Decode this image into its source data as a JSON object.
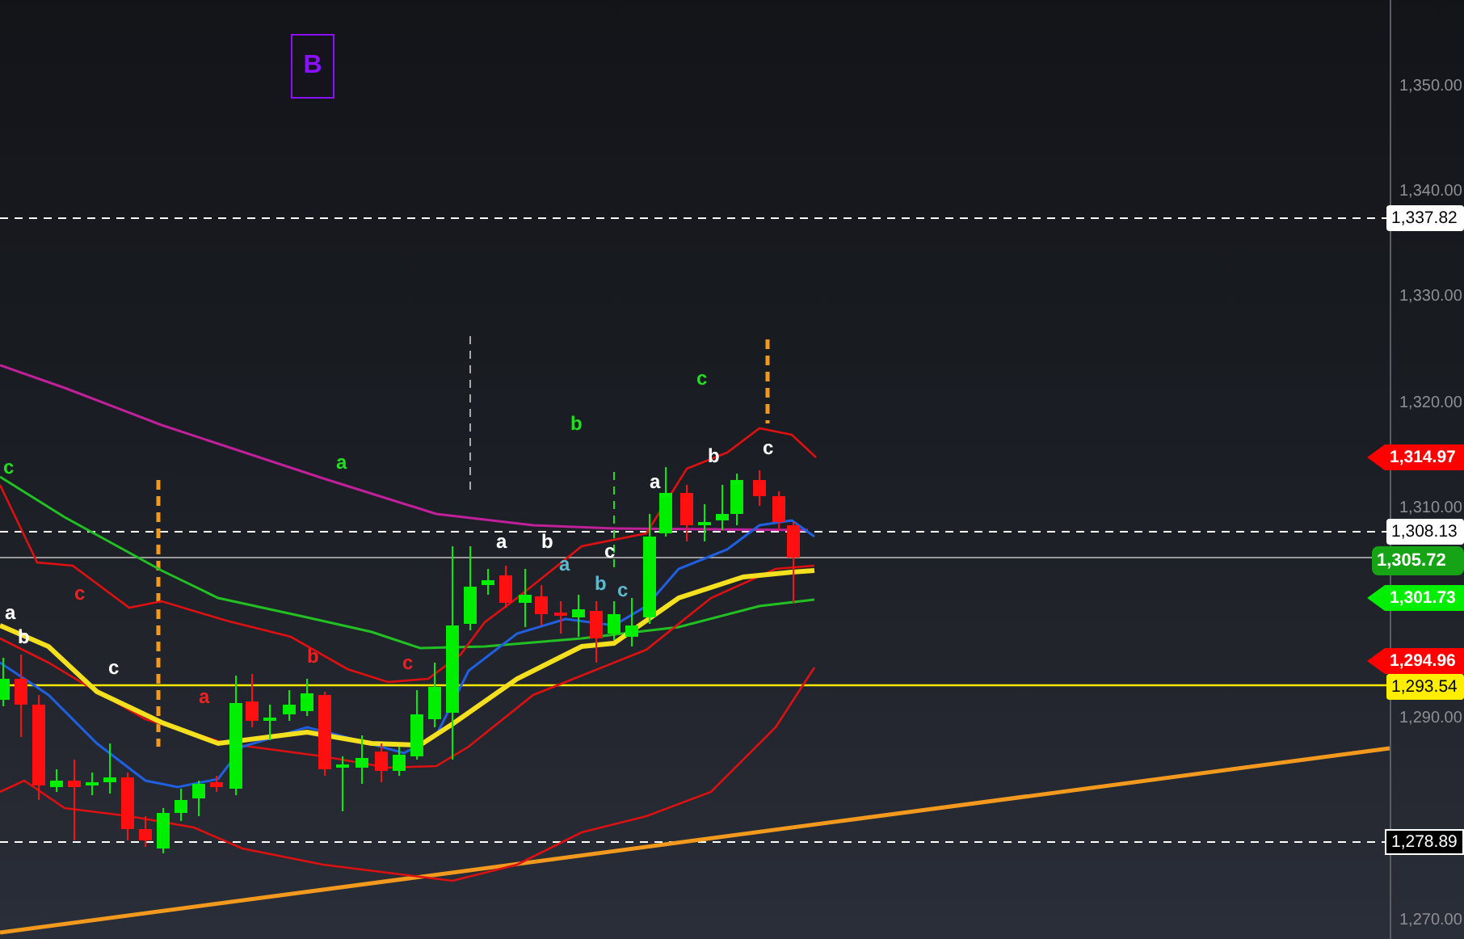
{
  "badge": {
    "text": "B"
  },
  "y_axis": {
    "ticks": [
      "1,350.00",
      "1,340.00",
      "1,330.00",
      "1,320.00",
      "1,310.00",
      "1,290.00",
      "1,270.00"
    ]
  },
  "price_tags": [
    {
      "text": "1,337.82",
      "kind": "box",
      "color": "#ffffff"
    },
    {
      "text": "1,314.97",
      "kind": "arrow",
      "color": "#ff0000"
    },
    {
      "text": "1,308.13",
      "kind": "box",
      "color": "#ffffff"
    },
    {
      "text": "1,305.72",
      "kind": "pill",
      "color": "#16a316"
    },
    {
      "text": "1,301.73",
      "kind": "arrow",
      "color": "#00ee00"
    },
    {
      "text": "1,294.96",
      "kind": "arrow",
      "color": "#ff0000"
    },
    {
      "text": "1,293.54",
      "kind": "box",
      "color": "#ffee00"
    },
    {
      "text": "1,278.89",
      "kind": "outlined",
      "color": "#000000"
    }
  ],
  "wave_labels": [
    {
      "text": "c",
      "color": "#22dd22"
    },
    {
      "text": "a",
      "color": "#ffffff"
    },
    {
      "text": "b",
      "color": "#ffffff"
    },
    {
      "text": "c",
      "color": "#ffffff"
    },
    {
      "text": "c",
      "color": "#ee2222"
    },
    {
      "text": "a",
      "color": "#ee2222"
    },
    {
      "text": "b",
      "color": "#ee2222"
    },
    {
      "text": "c",
      "color": "#ee2222"
    },
    {
      "text": "a",
      "color": "#22dd22"
    },
    {
      "text": "b",
      "color": "#22dd22"
    },
    {
      "text": "c",
      "color": "#22dd22"
    },
    {
      "text": "a",
      "color": "#ffffff"
    },
    {
      "text": "b",
      "color": "#ffffff"
    },
    {
      "text": "a",
      "color": "#5fb8d0"
    },
    {
      "text": "b",
      "color": "#5fb8d0"
    },
    {
      "text": "c",
      "color": "#ffffff"
    },
    {
      "text": "c",
      "color": "#5fb8d0"
    },
    {
      "text": "a",
      "color": "#ffffff"
    },
    {
      "text": "b",
      "color": "#ffffff"
    },
    {
      "text": "c",
      "color": "#ffffff"
    }
  ]
}
